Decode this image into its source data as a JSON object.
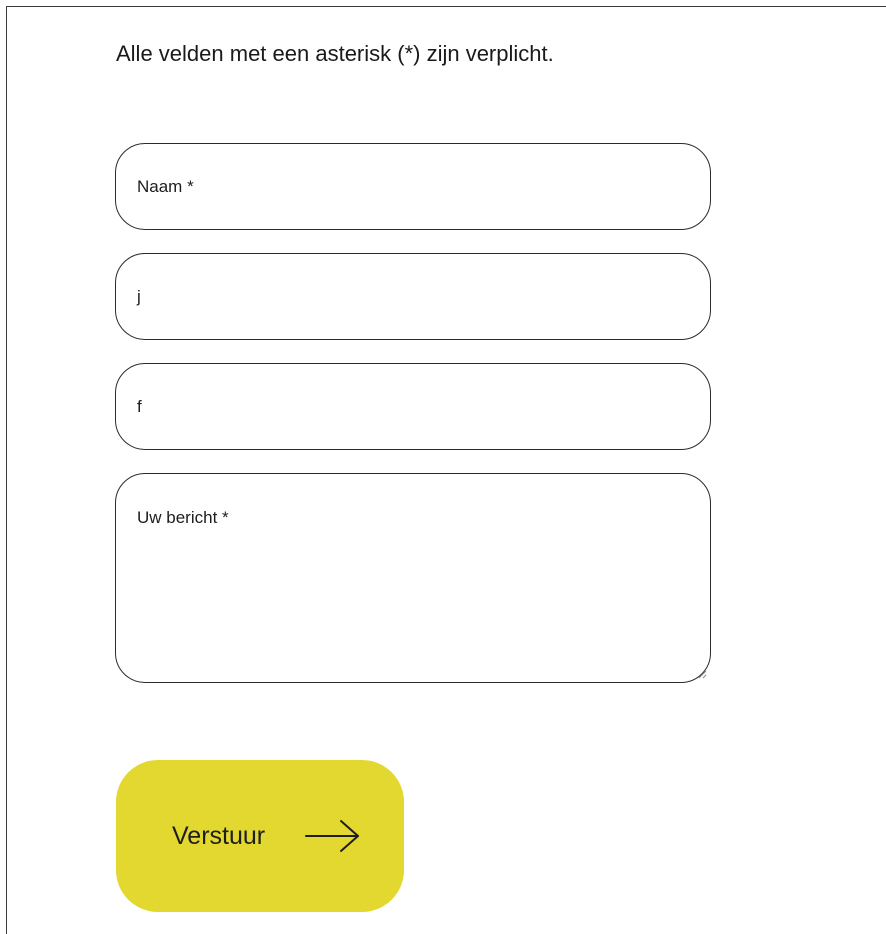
{
  "form": {
    "required_note": "Alle velden met een asterisk (*) zijn verplicht.",
    "fields": [
      {
        "type": "input",
        "value": "",
        "placeholder": "Naam *"
      },
      {
        "type": "input",
        "value": "j",
        "placeholder": ""
      },
      {
        "type": "input",
        "value": "f",
        "placeholder": ""
      },
      {
        "type": "textarea",
        "value": "",
        "placeholder": "Uw bericht *"
      }
    ],
    "submit": {
      "label": "Verstuur",
      "icon": "arrow-right-icon",
      "color": "#e2d82f"
    }
  }
}
